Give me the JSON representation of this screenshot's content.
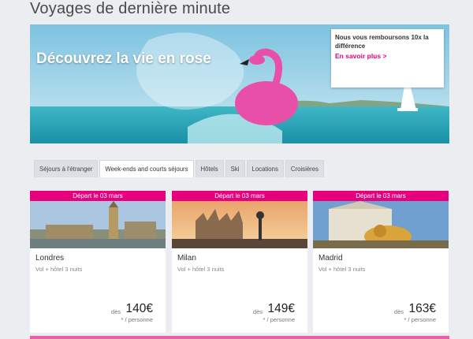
{
  "page": {
    "title": "Voyages de dernière minute"
  },
  "hero": {
    "headline": "Découvrez la vie en rose",
    "promo_text": "Nous vous remboursons 10x la différence",
    "promo_link": "En savoir plus >"
  },
  "tabs": [
    {
      "label": "Séjours à l'étranger",
      "active": false
    },
    {
      "label": "Week-ends and courts séjours",
      "active": true
    },
    {
      "label": "Hôtels",
      "active": false
    },
    {
      "label": "Ski",
      "active": false
    },
    {
      "label": "Locations",
      "active": false
    },
    {
      "label": "Croisières",
      "active": false
    }
  ],
  "deals": [
    {
      "banner": "Départ le 03 mars",
      "city": "Londres",
      "desc": "Vol + hôtel 3 nuits",
      "from": "dès",
      "price": "140€",
      "per": "* / personne"
    },
    {
      "banner": "Départ le 03 mars",
      "city": "Milan",
      "desc": "Vol + hôtel 3 nuits",
      "from": "dès",
      "price": "149€",
      "per": "* / personne"
    },
    {
      "banner": "Départ le 03 mars",
      "city": "Madrid",
      "desc": "Vol + hôtel 3 nuits",
      "from": "dès",
      "price": "163€",
      "per": "* / personne"
    }
  ],
  "colors": {
    "accent": "#e6007e",
    "background": "#ebedf0"
  }
}
